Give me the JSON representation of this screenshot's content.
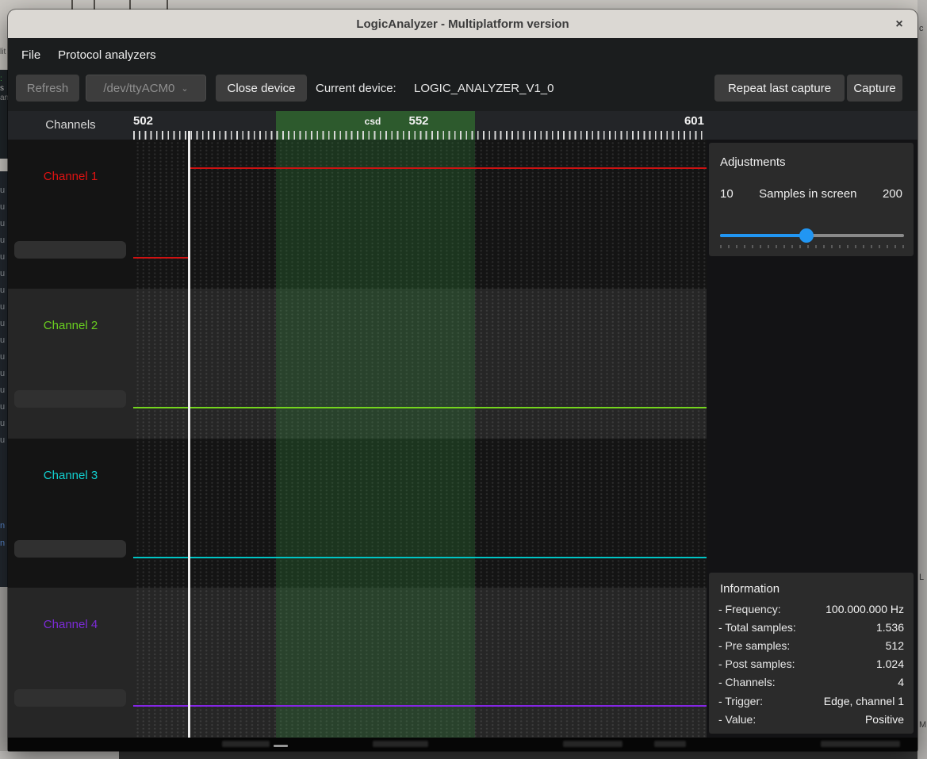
{
  "window": {
    "title": "LogicAnalyzer - Multiplatform version",
    "close": "×"
  },
  "menu": {
    "items": [
      {
        "label": "File"
      },
      {
        "label": "Protocol analyzers"
      }
    ]
  },
  "toolbar": {
    "refresh_label": "Refresh",
    "device_select_value": "/dev/ttyACM0",
    "device_select_chevron": "⌄",
    "close_device_label": "Close device",
    "current_device_label": "Current device:",
    "current_device_value": "LOGIC_ANALYZER_V1_0",
    "repeat_label": "Repeat last capture",
    "capture_label": "Capture"
  },
  "header": {
    "channels_label": "Channels",
    "tick_start": "502",
    "tick_mid": "552",
    "tick_end": "601",
    "region_label": "csd"
  },
  "channels": [
    {
      "label": "Channel 1",
      "color": "#de1212",
      "line_color": "#cf1212",
      "name_value": ""
    },
    {
      "label": "Channel 2",
      "color": "#69ce20",
      "line_color": "#74d51e",
      "name_value": ""
    },
    {
      "label": "Channel 3",
      "color": "#12cfcf",
      "line_color": "#00c4c4",
      "name_value": ""
    },
    {
      "label": "Channel 4",
      "color": "#7b2bd6",
      "line_color": "#8526e6",
      "name_value": ""
    }
  ],
  "adjustments": {
    "title": "Adjustments",
    "min": "10",
    "label": "Samples in screen",
    "max": "200",
    "value_fraction": 0.47,
    "accent_color": "#2196f3"
  },
  "information": {
    "title": "Information",
    "rows": [
      {
        "label": "- Frequency:",
        "value": "100.000.000 Hz"
      },
      {
        "label": "- Total samples:",
        "value": "1.536"
      },
      {
        "label": "- Pre samples:",
        "value": "512"
      },
      {
        "label": "- Post samples:",
        "value": "1.024"
      },
      {
        "label": "- Channels:",
        "value": "4"
      },
      {
        "label": "- Trigger:",
        "value": "Edge, channel 1"
      },
      {
        "label": "- Value:",
        "value": "Positive"
      }
    ]
  },
  "waveform": {
    "visible_range_labels": [
      "502",
      "552",
      "601"
    ],
    "highlight_region_label": "csd",
    "trigger_marker": "white vertical line",
    "channel_states": [
      {
        "channel": "Channel 1",
        "state": "low then rises to high at trigger marker"
      },
      {
        "channel": "Channel 2",
        "state": "constant low"
      },
      {
        "channel": "Channel 3",
        "state": "constant low"
      },
      {
        "channel": "Channel 4",
        "state": "constant low"
      }
    ]
  },
  "background_artifacts": {
    "left_top_text": "lit",
    "left_mid_chars": [
      ":",
      "s",
      "an"
    ],
    "left_text_column": "u\nu\nu\nu\nu\nu\nu\nu\nu\nu\nu\nu\nu\nu\nu\nu",
    "left_blue_chars": "n\nn",
    "right_chars": [
      "c",
      "L",
      "M"
    ]
  }
}
